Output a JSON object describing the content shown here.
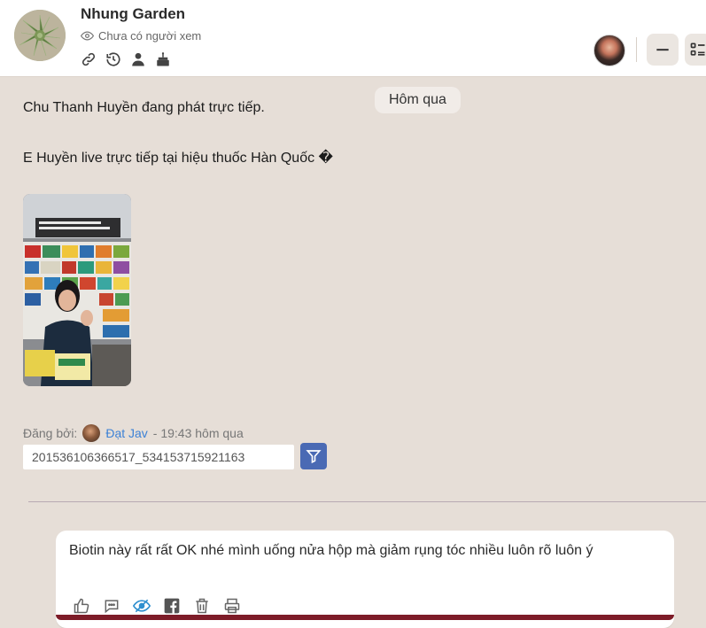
{
  "header": {
    "title": "Nhung Garden",
    "views_text": "Chưa có người xem",
    "meta_icons": [
      "link-icon",
      "history-icon",
      "user-icon",
      "birthday-cake-icon"
    ],
    "actions": [
      "minimize-button",
      "list-menu-button"
    ]
  },
  "post": {
    "date_label": "Hôm qua",
    "line1": "Chu Thanh Huyền đang phát trực tiếp.",
    "line2": "E Huyền live trực tiếp tại hiệu thuốc Hàn Quốc �",
    "posted_by_label": "Đăng bởi:",
    "author": "Đạt Jav",
    "time": "- 19:43 hôm qua",
    "post_id": "201536106366517_534153715921163"
  },
  "comment": {
    "text": "Biotin này rất rất OK nhé mình uống nửa hộp mà giảm rụng tóc nhiều luôn rõ luôn ý",
    "actions": [
      "like-icon",
      "reply-icon",
      "hide-icon",
      "facebook-icon",
      "delete-icon",
      "print-icon"
    ]
  },
  "colors": {
    "background": "#e6ded7",
    "header_bg": "#ffffff",
    "link_blue": "#3d82d6",
    "filter_button": "#4a6ab4",
    "accent_dark_red": "#7d1c28"
  }
}
